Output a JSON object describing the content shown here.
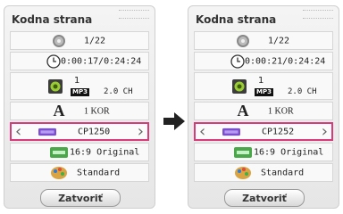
{
  "left_panel": {
    "title": "Kodna strana",
    "chapter": "1/22",
    "time": "0:00:17/0:24:24",
    "audio_track": "1",
    "audio_format": "MP3",
    "audio_channels": "2.0 CH",
    "subtitle_lang": "1 KOR",
    "code_page": "CP1250",
    "aspect": "16:9 Original",
    "picture_mode": "Standard",
    "close_label": "Zatvoriť"
  },
  "right_panel": {
    "title": "Kodna strana",
    "chapter": "1/22",
    "time": "0:00:21/0:24:24",
    "audio_track": "1",
    "audio_format": "MP3",
    "audio_channels": "2.0 CH",
    "subtitle_lang": "1 KOR",
    "code_page": "CP1252",
    "aspect": "16:9 Original",
    "picture_mode": "Standard",
    "close_label": "Zatvoriť"
  },
  "icons": {
    "chapter": "disc-icon",
    "time": "clock-icon",
    "audio": "speaker-icon",
    "subtitle": "letter-a-icon",
    "code_page": "abc-icon",
    "aspect": "aspect-ratio-icon",
    "picture": "palette-icon",
    "transition": "arrow-right-icon"
  },
  "colors": {
    "selection_border": "#d83a7a",
    "code_page_icon": "#7c4fd0",
    "aspect_icon": "#4aa84a"
  }
}
